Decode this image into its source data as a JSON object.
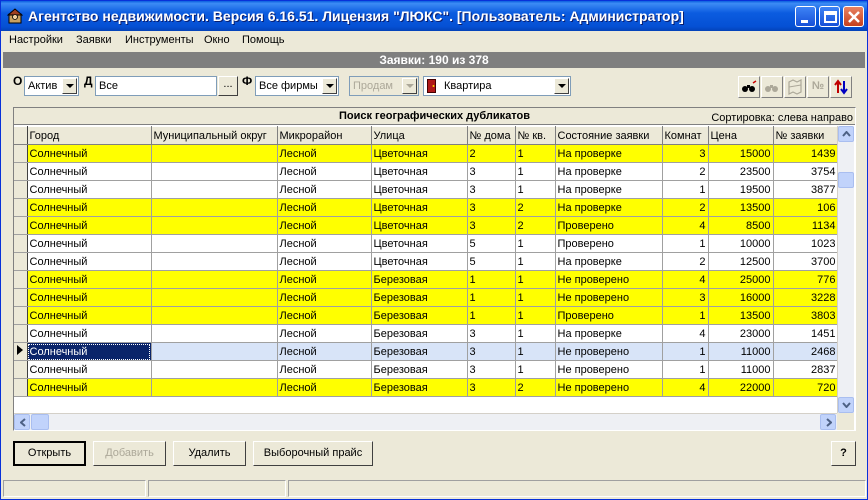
{
  "window": {
    "title": "Агентство недвижимости. Версия 6.16.51. Лицензия \"ЛЮКС\". [Пользователь: Администратор]"
  },
  "menu": [
    "Настройки",
    "Заявки",
    "Инструменты",
    "Окно",
    "Помощь"
  ],
  "header": {
    "count_text": "Заявки: 190 из 378"
  },
  "filters": {
    "o_label": "О",
    "o_value": "Актив",
    "d_label": "Д",
    "d_value": "Все",
    "browse_label": "...",
    "f_label": "Ф",
    "f_value": "Все фирмы",
    "deal_value": "Продам",
    "type_value": "Квартира"
  },
  "toolbar": {
    "n_label": "№"
  },
  "grid": {
    "title": "Поиск географических дубликатов",
    "sort_text": "Сортировка: слева направо",
    "columns": [
      "Город",
      "Муниципальный округ",
      "Микрорайон",
      "Улица",
      "№ дома",
      "№ кв.",
      "Состояние заявки",
      "Комнат",
      "Цена",
      "№ заявки"
    ],
    "rows": [
      {
        "city": "Солнечный",
        "district": "",
        "micro": "Лесной",
        "street": "Цветочная",
        "house": "2",
        "flat": "1",
        "state": "На проверке",
        "rooms": "3",
        "price": "15000",
        "id": "1439",
        "hl": true
      },
      {
        "city": "Солнечный",
        "district": "",
        "micro": "Лесной",
        "street": "Цветочная",
        "house": "3",
        "flat": "1",
        "state": "На проверке",
        "rooms": "2",
        "price": "23500",
        "id": "3754",
        "hl": false
      },
      {
        "city": "Солнечный",
        "district": "",
        "micro": "Лесной",
        "street": "Цветочная",
        "house": "3",
        "flat": "1",
        "state": "На проверке",
        "rooms": "1",
        "price": "19500",
        "id": "3877",
        "hl": false
      },
      {
        "city": "Солнечный",
        "district": "",
        "micro": "Лесной",
        "street": "Цветочная",
        "house": "3",
        "flat": "2",
        "state": "На проверке",
        "rooms": "2",
        "price": "13500",
        "id": "106",
        "hl": true
      },
      {
        "city": "Солнечный",
        "district": "",
        "micro": "Лесной",
        "street": "Цветочная",
        "house": "3",
        "flat": "2",
        "state": "Проверено",
        "rooms": "4",
        "price": "8500",
        "id": "1134",
        "hl": true
      },
      {
        "city": "Солнечный",
        "district": "",
        "micro": "Лесной",
        "street": "Цветочная",
        "house": "5",
        "flat": "1",
        "state": "Проверено",
        "rooms": "1",
        "price": "10000",
        "id": "1023",
        "hl": false
      },
      {
        "city": "Солнечный",
        "district": "",
        "micro": "Лесной",
        "street": "Цветочная",
        "house": "5",
        "flat": "1",
        "state": "На проверке",
        "rooms": "2",
        "price": "12500",
        "id": "3700",
        "hl": false
      },
      {
        "city": "Солнечный",
        "district": "",
        "micro": "Лесной",
        "street": "Березовая",
        "house": "1",
        "flat": "1",
        "state": "Не проверено",
        "rooms": "4",
        "price": "25000",
        "id": "776",
        "hl": true
      },
      {
        "city": "Солнечный",
        "district": "",
        "micro": "Лесной",
        "street": "Березовая",
        "house": "1",
        "flat": "1",
        "state": "Не проверено",
        "rooms": "3",
        "price": "16000",
        "id": "3228",
        "hl": true
      },
      {
        "city": "Солнечный",
        "district": "",
        "micro": "Лесной",
        "street": "Березовая",
        "house": "1",
        "flat": "1",
        "state": "Проверено",
        "rooms": "1",
        "price": "13500",
        "id": "3803",
        "hl": true
      },
      {
        "city": "Солнечный",
        "district": "",
        "micro": "Лесной",
        "street": "Березовая",
        "house": "3",
        "flat": "1",
        "state": "На проверке",
        "rooms": "4",
        "price": "23000",
        "id": "1451",
        "hl": false
      },
      {
        "city": "Солнечный",
        "district": "",
        "micro": "Лесной",
        "street": "Березовая",
        "house": "3",
        "flat": "1",
        "state": "Не проверено",
        "rooms": "1",
        "price": "11000",
        "id": "2468",
        "hl": false,
        "selected": true
      },
      {
        "city": "Солнечный",
        "district": "",
        "micro": "Лесной",
        "street": "Березовая",
        "house": "3",
        "flat": "1",
        "state": "Не проверено",
        "rooms": "1",
        "price": "11000",
        "id": "2837",
        "hl": false
      },
      {
        "city": "Солнечный",
        "district": "",
        "micro": "Лесной",
        "street": "Березовая",
        "house": "3",
        "flat": "2",
        "state": "Не проверено",
        "rooms": "4",
        "price": "22000",
        "id": "720",
        "hl": true
      }
    ]
  },
  "buttons": {
    "open": "Открыть",
    "add": "Добавить",
    "delete": "Удалить",
    "price_list": "Выборочный прайс",
    "help": "?"
  },
  "colors": {
    "highlight": "#ffff00",
    "titlebar": "#0550d4"
  }
}
